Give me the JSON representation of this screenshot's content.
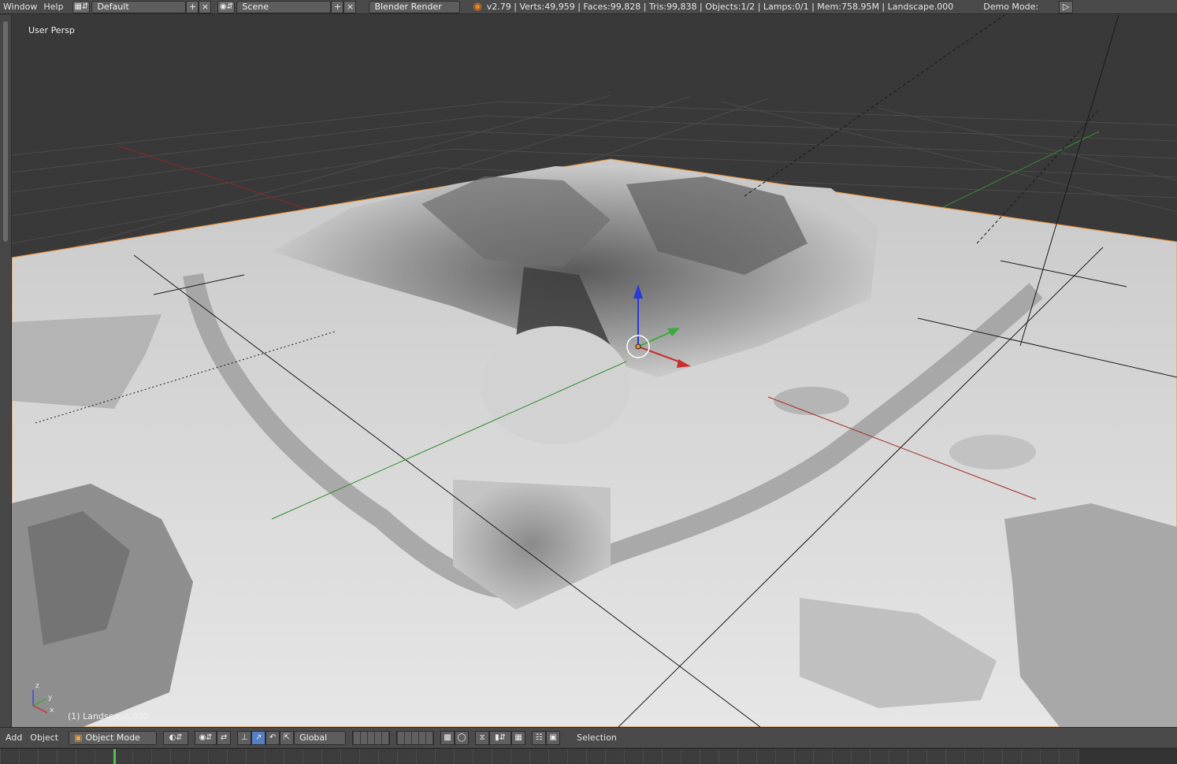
{
  "topbar": {
    "window_menu": "Window",
    "help_menu": "Help",
    "screen_layout": "Default",
    "scene": "Scene",
    "render_engine": "Blender Render",
    "stats": "v2.79 | Verts:49,959 | Faces:99,828 | Tris:99,838 | Objects:1/2 | Lamps:0/1 | Mem:758.95M | Landscape.000",
    "demo_mode": "Demo Mode:",
    "icons": [
      "layout-icon",
      "scene-icon",
      "blender-logo-icon",
      "play-icon"
    ]
  },
  "viewport": {
    "view_label": "User Persp",
    "object_label": "(1) Landscape.000",
    "axis_labels": {
      "x": "x",
      "y": "y",
      "z": "z"
    },
    "colors": {
      "background": "#393939",
      "x_axis": "#b03030",
      "y_axis": "#3a9a3a",
      "z_axis": "#2a3ad8",
      "selection_outline": "#f09030"
    }
  },
  "bottombar": {
    "add_menu": "Add",
    "object_menu": "Object",
    "mode": "Object Mode",
    "orientation": "Global",
    "selection_label": "Selection",
    "icons": [
      "cube-icon",
      "shading-sphere-icon",
      "pivot-icon",
      "manipulator-icon",
      "translate-icon",
      "rotate-icon",
      "scale-icon",
      "layers-icon",
      "lock-icon",
      "proportional-icon",
      "snap-icon",
      "render-icon",
      "camera-icon"
    ]
  },
  "timeline": {
    "current_frame_marker": "green"
  }
}
